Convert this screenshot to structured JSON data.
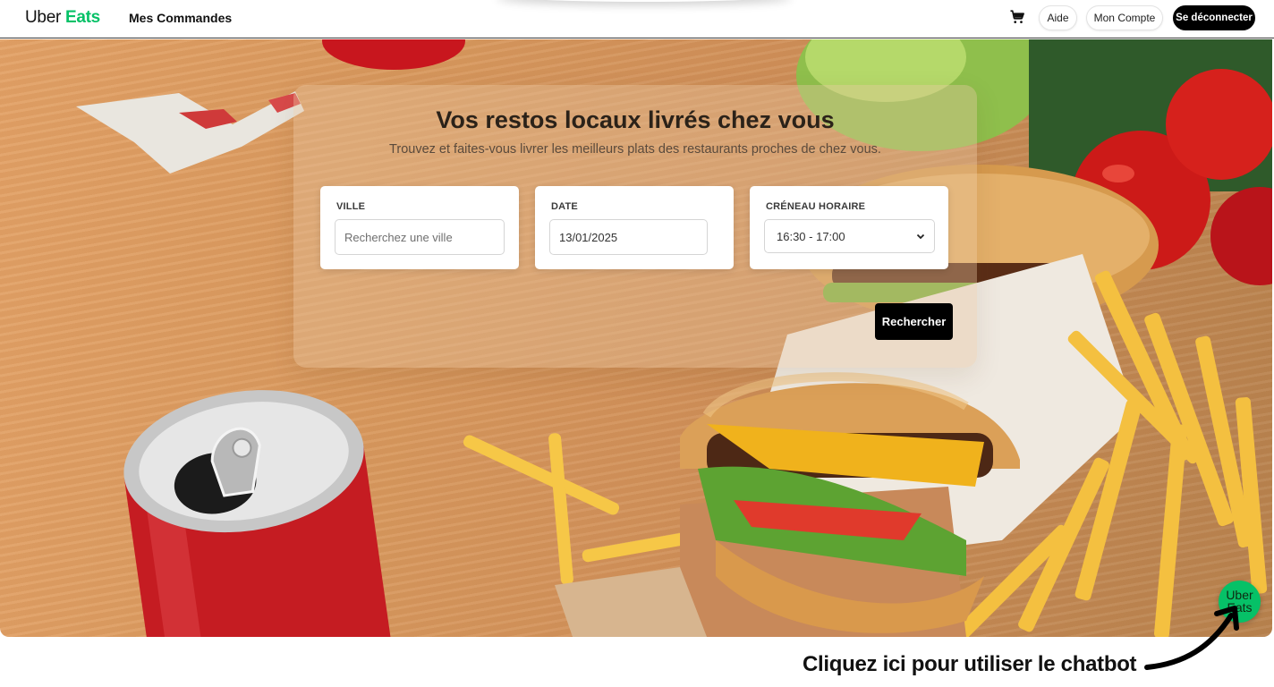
{
  "brand": {
    "word1": "Uber",
    "word2": "Eats",
    "green": "#06c167"
  },
  "nav": {
    "orders": "Mes Commandes"
  },
  "header_actions": {
    "cart_icon": "cart-icon",
    "help": "Aide",
    "account": "Mon Compte",
    "logout": "Se déconnecter"
  },
  "hero": {
    "title": "Vos restos locaux livrés chez vous",
    "subtitle": "Trouvez et faites-vous livrer les meilleurs plats des restaurants proches de chez vous.",
    "city": {
      "label": "VILLE",
      "placeholder": "Recherchez une ville",
      "value": ""
    },
    "date": {
      "label": "DATE",
      "value": "13/01/2025"
    },
    "slot": {
      "label": "CRÉNEAU HORAIRE",
      "selected": "16:30 - 17:00"
    },
    "search_button": "Rechercher"
  },
  "chatbot": {
    "bubble_line1": "Uber",
    "bubble_line2": "Eats",
    "cta": "Cliquez ici pour utiliser le chatbot"
  }
}
